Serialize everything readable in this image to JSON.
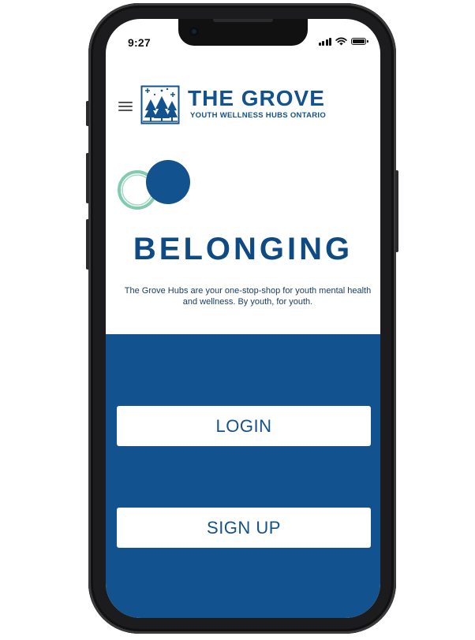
{
  "status_bar": {
    "time": "9:27"
  },
  "header": {
    "brand_title": "THE GROVE",
    "brand_subtitle": "YOUTH WELLNESS HUBS ONTARIO"
  },
  "hero": {
    "headline": "BELONGING",
    "tagline": "The Grove Hubs are your one-stop-shop for youth mental health and wellness. By youth, for youth."
  },
  "actions": {
    "login_label": "LOGIN",
    "signup_label": "SIGN UP"
  },
  "colors": {
    "brand_blue": "#12528f",
    "headline_blue": "#0e4a84",
    "accent_green": "#6cc3a0",
    "panel_blue": "#12528f",
    "button_bg": "#ffffff"
  },
  "icons": [
    "hamburger-menu-icon",
    "logo-forest-icon",
    "signal-icon",
    "wifi-icon",
    "battery-icon"
  ]
}
